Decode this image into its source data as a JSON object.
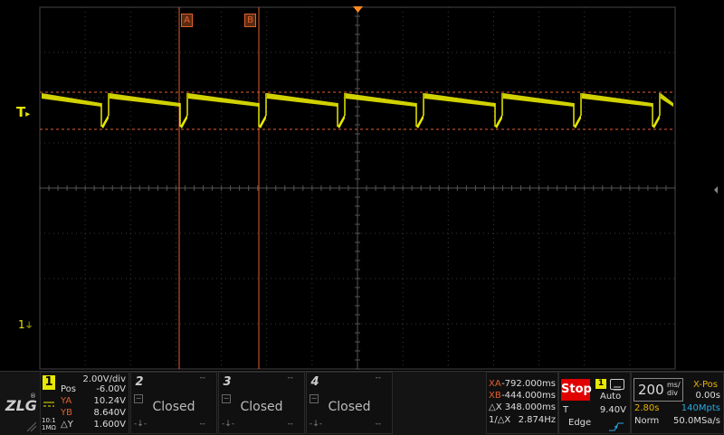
{
  "cursors": {
    "a_label": "A",
    "b_label": "B"
  },
  "markers": {
    "trigger_label": "T",
    "ch1_ground_label": "1"
  },
  "channel1": {
    "number": "1",
    "volts_div": "2.00V/div",
    "pos_label": "Pos",
    "pos_value": "-6.00V",
    "ya_label": "YA",
    "ya_value": "10.24V",
    "yb_label": "YB",
    "yb_value": "8.640V",
    "dy_label": "△Y",
    "dy_value": "1.600V",
    "coupling": "DC",
    "probe": "10:1",
    "impedance": "1MΩ"
  },
  "channels_closed": [
    {
      "number": "2",
      "status": "Closed",
      "dash": "--"
    },
    {
      "number": "3",
      "status": "Closed",
      "dash": "--"
    },
    {
      "number": "4",
      "status": "Closed",
      "dash": "--"
    }
  ],
  "measure": {
    "xa_label": "XA",
    "xa_value": "-792.000ms",
    "xb_label": "XB",
    "xb_value": "-444.000ms",
    "dx_label": "△X",
    "dx_value": "348.000ms",
    "inv_label": "1/△X",
    "inv_value": "2.874Hz"
  },
  "run": {
    "state": "Stop",
    "trigger_source": "1",
    "trigger_mode": "Auto",
    "trigger_label": "T",
    "trigger_level": "9.40V",
    "trigger_type": "Edge"
  },
  "timebase": {
    "value": "200",
    "unit_top": "ms/",
    "unit_bottom": "div",
    "xpos_label": "X-Pos",
    "xpos_value": "0.00s",
    "record_time": "2.80s",
    "memory_depth": "140Mpts",
    "acq_mode": "Norm",
    "sample_rate": "50.0MSa/s"
  },
  "colors": {
    "ch1": "#e8e800",
    "cursor": "#e06030",
    "grid": "#3a3a3a",
    "stop": "#e00000",
    "accent_cyan": "#29a8e0"
  },
  "icons": [
    "zlg-logo-icon",
    "trigger-edge-icon",
    "right-edge-arrow-icon",
    "trigger-level-icon",
    "ground-marker-icon"
  ]
}
